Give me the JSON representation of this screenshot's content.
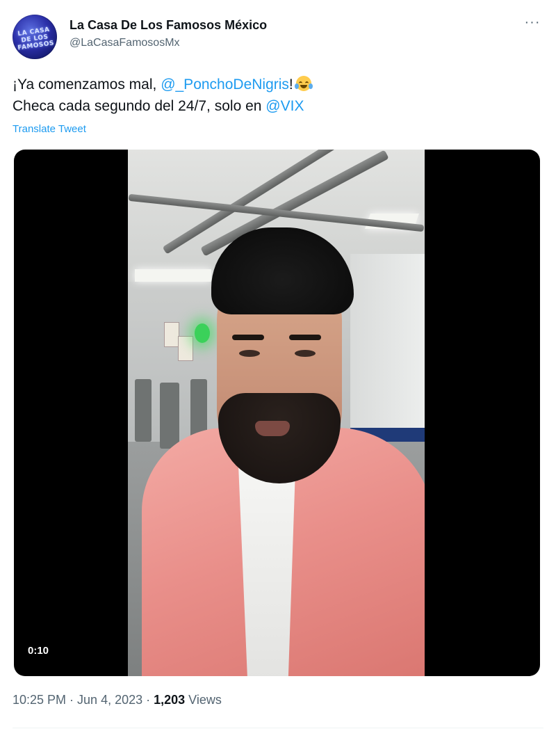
{
  "author": {
    "display_name": "La Casa De Los Famosos México",
    "handle": "@LaCasaFamososMx",
    "avatar_text": "LA CASA DE LOS FAMOSOS"
  },
  "tweet": {
    "line1_prefix": "¡Ya comenzamos mal, ",
    "line1_mention": "@_PonchoDeNigris",
    "line1_suffix": "!",
    "line1_emoji": "face-with-tears-of-joy-icon",
    "line2_prefix": "Checa cada segundo del 24/7, solo en ",
    "line2_mention": "@VIX",
    "translate_label": "Translate Tweet"
  },
  "media": {
    "type": "video",
    "duration": "0:10"
  },
  "meta": {
    "time": "10:25 PM",
    "separator1": " · ",
    "date": "Jun 4, 2023",
    "separator2": " · ",
    "views_count": "1,203",
    "views_label": " Views"
  },
  "more_icon": "more-options-icon",
  "colors": {
    "link": "#1d9bf0",
    "text": "#0f1419",
    "secondary": "#536471"
  }
}
